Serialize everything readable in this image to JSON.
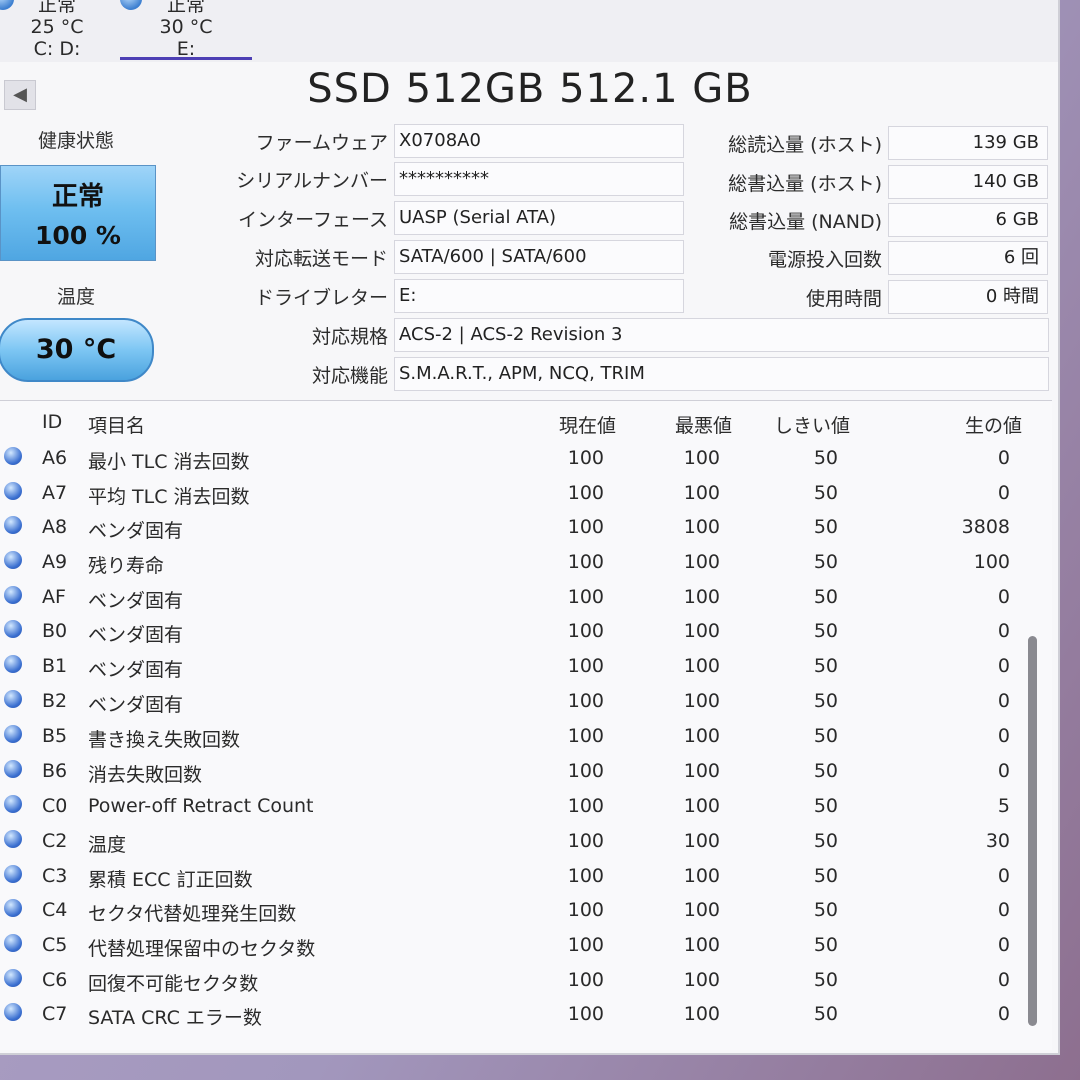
{
  "disk_tabs": [
    {
      "status": "正常",
      "temperature": "25 °C",
      "drives": "C: D:"
    },
    {
      "status": "正常",
      "temperature": "30 °C",
      "drives": "E:"
    }
  ],
  "title": "SSD 512GB 512.1 GB",
  "health": {
    "label": "健康状態",
    "status": "正常",
    "percent": "100 %"
  },
  "temperature": {
    "label": "温度",
    "value": "30 °C"
  },
  "info": {
    "firmware": {
      "label": "ファームウェア",
      "value": "X0708A0"
    },
    "serial": {
      "label": "シリアルナンバー",
      "value": "**********"
    },
    "interface": {
      "label": "インターフェース",
      "value": "UASP (Serial ATA)"
    },
    "transfer_mode": {
      "label": "対応転送モード",
      "value": "SATA/600 | SATA/600"
    },
    "drive_letter": {
      "label": "ドライブレター",
      "value": "E:"
    },
    "standard": {
      "label": "対応規格",
      "value": "ACS-2 | ACS-2 Revision 3"
    },
    "features": {
      "label": "対応機能",
      "value": "S.M.A.R.T., APM, NCQ, TRIM"
    }
  },
  "stats": {
    "host_reads": {
      "label": "総読込量 (ホスト)",
      "value": "139 GB"
    },
    "host_writes": {
      "label": "総書込量 (ホスト)",
      "value": "140 GB"
    },
    "nand_writes": {
      "label": "総書込量 (NAND)",
      "value": "6 GB"
    },
    "power_on_count": {
      "label": "電源投入回数",
      "value": "6 回"
    },
    "power_on_hours": {
      "label": "使用時間",
      "value": "0 時間"
    }
  },
  "smart": {
    "headers": {
      "id": "ID",
      "name": "項目名",
      "current": "現在値",
      "worst": "最悪値",
      "threshold": "しきい値",
      "raw": "生の値"
    },
    "rows": [
      {
        "id": "A6",
        "name": "最小 TLC 消去回数",
        "current": "100",
        "worst": "100",
        "threshold": "50",
        "raw": "0"
      },
      {
        "id": "A7",
        "name": "平均 TLC 消去回数",
        "current": "100",
        "worst": "100",
        "threshold": "50",
        "raw": "0"
      },
      {
        "id": "A8",
        "name": "ベンダ固有",
        "current": "100",
        "worst": "100",
        "threshold": "50",
        "raw": "3808"
      },
      {
        "id": "A9",
        "name": "残り寿命",
        "current": "100",
        "worst": "100",
        "threshold": "50",
        "raw": "100"
      },
      {
        "id": "AF",
        "name": "ベンダ固有",
        "current": "100",
        "worst": "100",
        "threshold": "50",
        "raw": "0"
      },
      {
        "id": "B0",
        "name": "ベンダ固有",
        "current": "100",
        "worst": "100",
        "threshold": "50",
        "raw": "0"
      },
      {
        "id": "B1",
        "name": "ベンダ固有",
        "current": "100",
        "worst": "100",
        "threshold": "50",
        "raw": "0"
      },
      {
        "id": "B2",
        "name": "ベンダ固有",
        "current": "100",
        "worst": "100",
        "threshold": "50",
        "raw": "0"
      },
      {
        "id": "B5",
        "name": "書き換え失敗回数",
        "current": "100",
        "worst": "100",
        "threshold": "50",
        "raw": "0"
      },
      {
        "id": "B6",
        "name": "消去失敗回数",
        "current": "100",
        "worst": "100",
        "threshold": "50",
        "raw": "0"
      },
      {
        "id": "C0",
        "name": "Power-off Retract Count",
        "current": "100",
        "worst": "100",
        "threshold": "50",
        "raw": "5"
      },
      {
        "id": "C2",
        "name": "温度",
        "current": "100",
        "worst": "100",
        "threshold": "50",
        "raw": "30"
      },
      {
        "id": "C3",
        "name": "累積 ECC 訂正回数",
        "current": "100",
        "worst": "100",
        "threshold": "50",
        "raw": "0"
      },
      {
        "id": "C4",
        "name": "セクタ代替処理発生回数",
        "current": "100",
        "worst": "100",
        "threshold": "50",
        "raw": "0"
      },
      {
        "id": "C5",
        "name": "代替処理保留中のセクタ数",
        "current": "100",
        "worst": "100",
        "threshold": "50",
        "raw": "0"
      },
      {
        "id": "C6",
        "name": "回復不可能セクタ数",
        "current": "100",
        "worst": "100",
        "threshold": "50",
        "raw": "0"
      },
      {
        "id": "C7",
        "name": "SATA CRC エラー数",
        "current": "100",
        "worst": "100",
        "threshold": "50",
        "raw": "0"
      }
    ]
  },
  "colors": {
    "health_good": "#6fbff0",
    "tab_accent": "#4d3fb4",
    "status_dot": "#3a6fd0"
  }
}
